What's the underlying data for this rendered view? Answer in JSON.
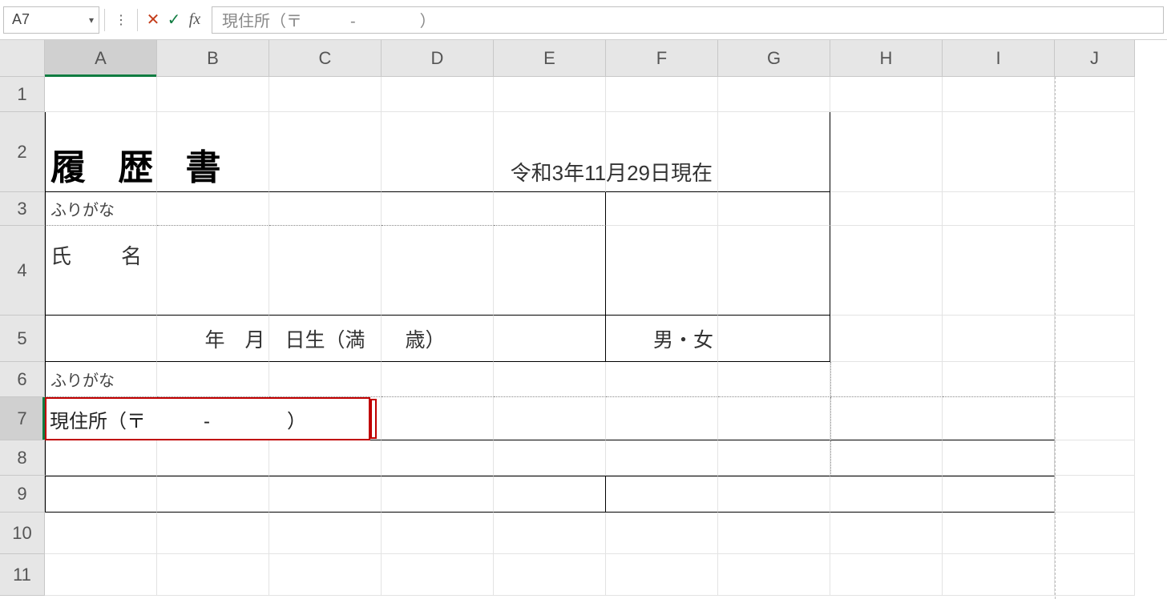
{
  "formula_bar": {
    "name_box": "A7",
    "cancel_glyph": "✕",
    "enter_glyph": "✓",
    "fx_label": "fx",
    "formula_text": "現住所（〒　　　-　　　　）"
  },
  "columns": [
    "A",
    "B",
    "C",
    "D",
    "E",
    "F",
    "G",
    "H",
    "I",
    "J"
  ],
  "row_numbers": [
    "1",
    "2",
    "3",
    "4",
    "5",
    "6",
    "7",
    "8",
    "9",
    "10",
    "11"
  ],
  "cells": {
    "title": "履 歴 書",
    "date": "令和3年11月29日現在",
    "furigana": "ふりがな",
    "name_label": "氏　名",
    "birth_row": "年　月　日生（満　　歳）",
    "gender": "男・女",
    "furigana2": "ふりがな",
    "address_edit": "現住所（〒　　　-　　　　）"
  },
  "selection": {
    "cell": "A7",
    "row": 7,
    "col": "A"
  }
}
